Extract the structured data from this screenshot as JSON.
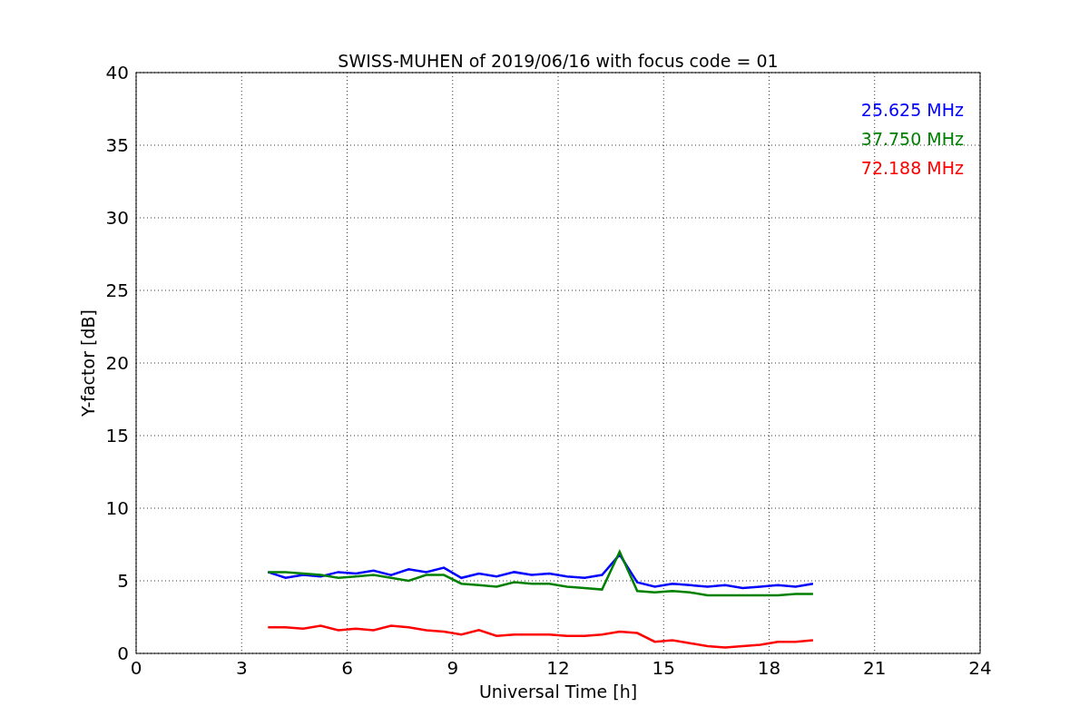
{
  "figure": {
    "chart_data": {
      "type": "line",
      "title": "SWISS-MUHEN of 2019/06/16 with focus code = 01",
      "xlabel": "Universal Time [h]",
      "ylabel": "Y-factor [dB]",
      "x": [
        3.75,
        4.25,
        4.75,
        5.25,
        5.75,
        6.25,
        6.75,
        7.25,
        7.75,
        8.25,
        8.75,
        9.25,
        9.75,
        10.25,
        10.75,
        11.25,
        11.75,
        12.25,
        12.75,
        13.25,
        13.75,
        14.25,
        14.75,
        15.25,
        15.75,
        16.25,
        16.75,
        17.25,
        17.75,
        18.25,
        18.75,
        19.25
      ],
      "series": [
        {
          "name": "25.625 MHz",
          "color": "#0000ff",
          "values": [
            5.6,
            5.2,
            5.4,
            5.3,
            5.6,
            5.5,
            5.7,
            5.4,
            5.8,
            5.6,
            5.9,
            5.2,
            5.5,
            5.3,
            5.6,
            5.4,
            5.5,
            5.3,
            5.2,
            5.4,
            6.8,
            4.9,
            4.6,
            4.8,
            4.7,
            4.6,
            4.7,
            4.5,
            4.6,
            4.7,
            4.6,
            4.8
          ]
        },
        {
          "name": "37.750 MHz",
          "color": "#008000",
          "values": [
            5.6,
            5.6,
            5.5,
            5.4,
            5.2,
            5.3,
            5.4,
            5.2,
            5.0,
            5.4,
            5.4,
            4.8,
            4.7,
            4.6,
            4.9,
            4.8,
            4.8,
            4.6,
            4.5,
            4.4,
            7.0,
            4.3,
            4.2,
            4.3,
            4.2,
            4.0,
            4.0,
            4.0,
            4.0,
            4.0,
            4.1,
            4.1
          ]
        },
        {
          "name": "72.188 MHz",
          "color": "#ff0000",
          "values": [
            1.8,
            1.8,
            1.7,
            1.9,
            1.6,
            1.7,
            1.6,
            1.9,
            1.8,
            1.6,
            1.5,
            1.3,
            1.6,
            1.2,
            1.3,
            1.3,
            1.3,
            1.2,
            1.2,
            1.3,
            1.5,
            1.4,
            0.8,
            0.9,
            0.7,
            0.5,
            0.4,
            0.5,
            0.6,
            0.8,
            0.8,
            0.9
          ]
        }
      ],
      "xlim": [
        0,
        24
      ],
      "ylim": [
        0,
        40
      ],
      "xticks": [
        0,
        3,
        6,
        9,
        12,
        15,
        18,
        21,
        24
      ],
      "yticks": [
        0,
        5,
        10,
        15,
        20,
        25,
        30,
        35,
        40
      ],
      "grid": true
    }
  }
}
